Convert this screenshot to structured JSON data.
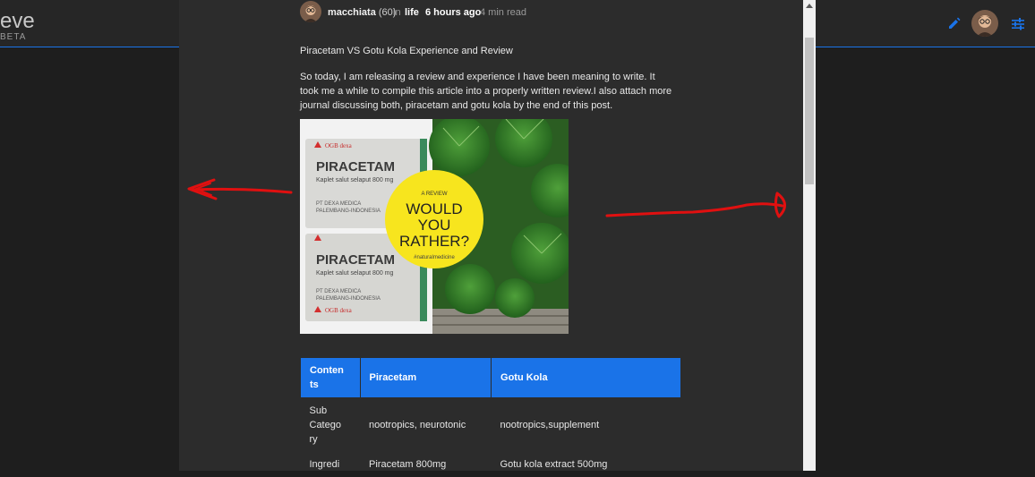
{
  "app": {
    "brand_name": "eve",
    "brand_badge": "BETA",
    "header_icons": [
      "pencil-icon",
      "avatar",
      "sliders-icon"
    ],
    "accent_color": "#1a73e8"
  },
  "post": {
    "author": "macchiata",
    "reputation": "(60)",
    "in_label": "in",
    "category": "life",
    "time": "6 hours ago",
    "read_time": "4 min read",
    "title": "Piracetam VS Gotu Kola Experience and Review",
    "body": "So today, I am releasing a review and experience I have been meaning to write. It took me a while to compile this article into a properly written review.I also attach more journal discussing both, piracetam and gotu kola by the end of this post.",
    "image": {
      "box_lines": [
        "PIRACETAM",
        "Kaplet salut selaput 800 mg",
        "PT DEXA MEDICA",
        "PALEMBANG-INDONESIA",
        "OGB dexa"
      ],
      "circle_small": "A REVIEW",
      "circle_line1": "WOULD",
      "circle_line2": "YOU",
      "circle_line3": "RATHER?",
      "circle_tag": "#naturalmedicine"
    },
    "table": {
      "headers": [
        "Conten ts",
        "Piracetam",
        "Gotu Kola"
      ],
      "rows": [
        [
          "Sub Catego ry",
          "nootropics, neurotonic",
          "nootropics,supplement"
        ],
        [
          "Ingredi",
          "Piracetam 800mg",
          "Gotu kola extract 500mg"
        ]
      ]
    }
  }
}
